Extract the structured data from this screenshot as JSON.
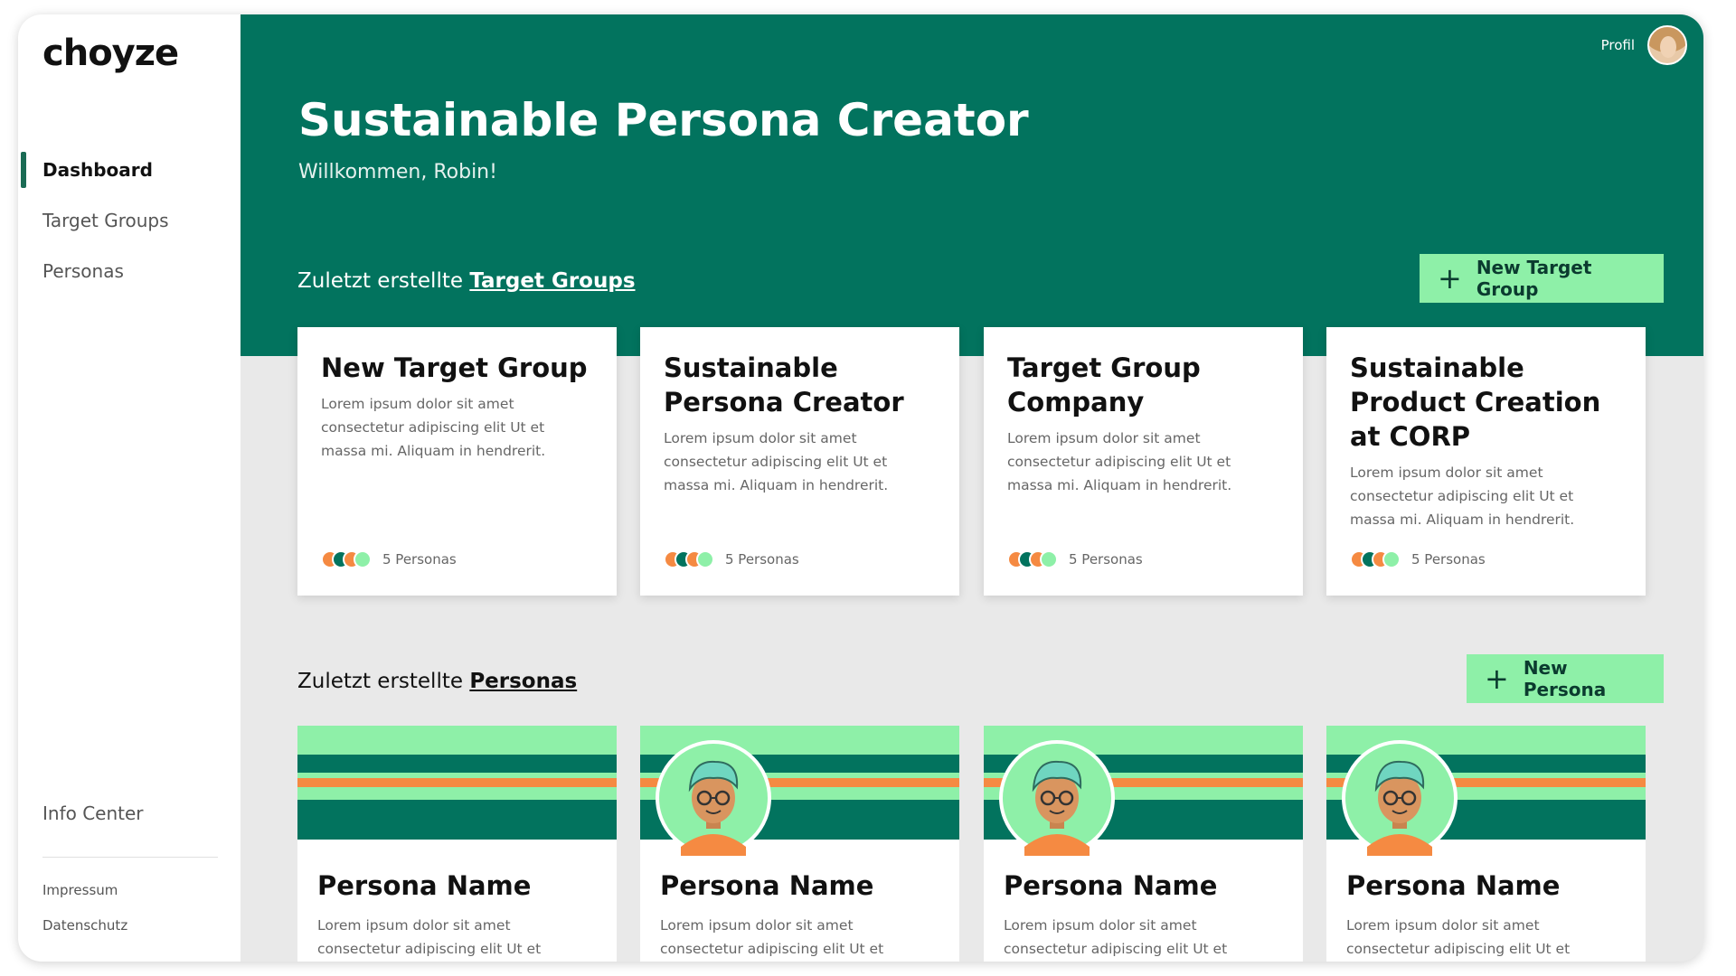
{
  "brand": {
    "logo": "choyze"
  },
  "sidebar": {
    "items": [
      {
        "label": "Dashboard",
        "active": true
      },
      {
        "label": "Target Groups",
        "active": false
      },
      {
        "label": "Personas",
        "active": false
      }
    ],
    "info_center": "Info Center",
    "footer": {
      "impressum": "Impressum",
      "datenschutz": "Datenschutz"
    }
  },
  "header": {
    "profile_label": "Profil",
    "title": "Sustainable Persona Creator",
    "welcome": "Willkommen, Robin!"
  },
  "target_groups_section": {
    "prefix": "Zuletzt erstellte ",
    "link": "Target Groups",
    "button": "New Target Group",
    "cards": [
      {
        "title": "New Target Group",
        "desc": "Lorem ipsum dolor sit amet consectetur adipiscing elit Ut et massa mi. Aliquam in hendrerit.",
        "personas": "5 Personas"
      },
      {
        "title": "Sustainable Persona Creator",
        "desc": "Lorem ipsum dolor sit amet consectetur adipiscing elit Ut et massa mi. Aliquam in hendrerit.",
        "personas": "5 Personas"
      },
      {
        "title": "Target Group Company",
        "desc": "Lorem ipsum dolor sit amet consectetur adipiscing elit Ut et massa mi. Aliquam in hendrerit.",
        "personas": "5 Personas"
      },
      {
        "title": "Sustainable Product Creation at  CORP",
        "desc": "Lorem ipsum dolor sit amet consectetur adipiscing elit Ut et massa mi. Aliquam in hendrerit.",
        "personas": "5 Personas"
      }
    ]
  },
  "personas_section": {
    "prefix": "Zuletzt erstellte ",
    "link": "Personas",
    "button": "New Persona",
    "cards": [
      {
        "name": "Persona Name",
        "desc": "Lorem ipsum dolor sit amet consectetur adipiscing elit Ut et",
        "has_avatar": false
      },
      {
        "name": "Persona Name",
        "desc": "Lorem ipsum dolor sit amet consectetur adipiscing elit Ut et",
        "has_avatar": true
      },
      {
        "name": "Persona Name",
        "desc": "Lorem ipsum dolor sit amet consectetur adipiscing elit Ut et",
        "has_avatar": true
      },
      {
        "name": "Persona Name",
        "desc": "Lorem ipsum dolor sit amet consectetur adipiscing elit Ut et",
        "has_avatar": true
      }
    ]
  },
  "colors": {
    "primary": "#02735e",
    "accent": "#8ef0a8",
    "orange": "#f58a42",
    "background": "#e9e9e9"
  },
  "icons": {
    "plus": "plus-icon",
    "avatar": "persona-avatar-icon",
    "profile": "profile-avatar"
  }
}
